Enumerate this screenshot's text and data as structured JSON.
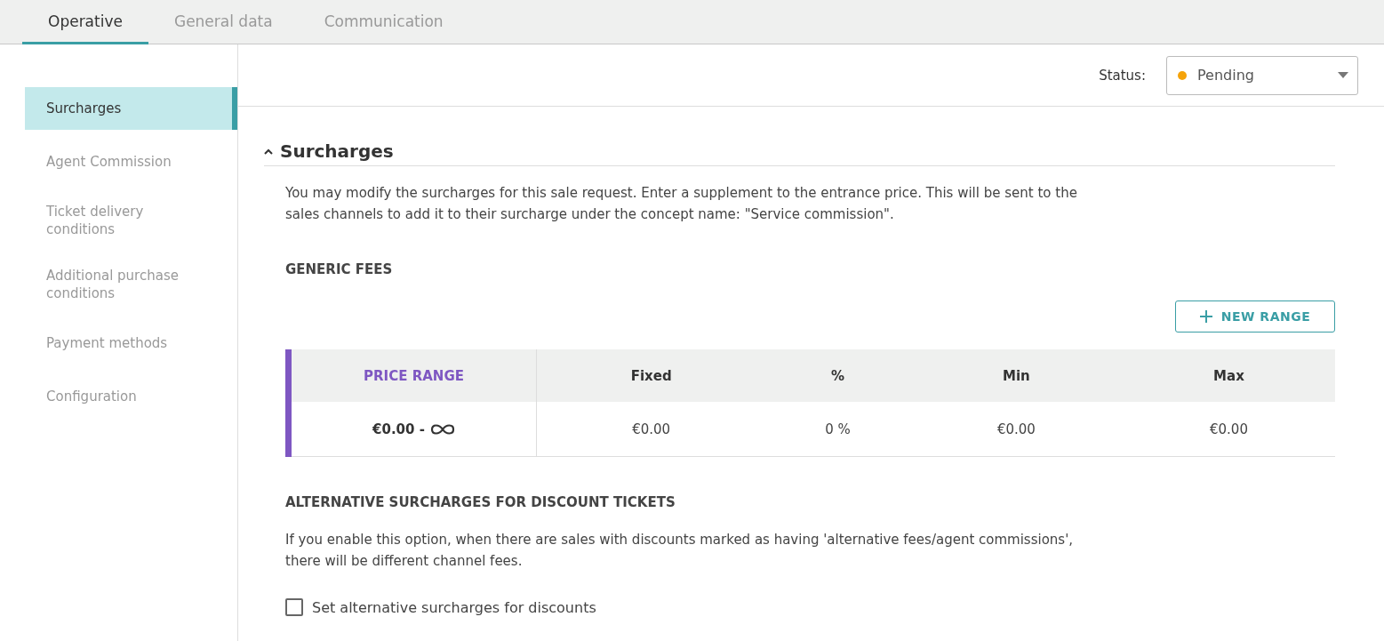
{
  "tabs": [
    {
      "label": "Operative",
      "selected": true
    },
    {
      "label": "General data",
      "selected": false
    },
    {
      "label": "Communication",
      "selected": false
    }
  ],
  "sidebar": {
    "items": [
      {
        "label": "Surcharges",
        "selected": true
      },
      {
        "label": "Agent Commission",
        "selected": false
      },
      {
        "label": "Ticket delivery conditions",
        "selected": false
      },
      {
        "label": "Additional purchase conditions",
        "selected": false
      },
      {
        "label": "Payment methods",
        "selected": false
      },
      {
        "label": "Configuration",
        "selected": false
      }
    ]
  },
  "status": {
    "label": "Status:",
    "value": "Pending",
    "color": "#f5a30a"
  },
  "section": {
    "title": "Surcharges",
    "expanded": true,
    "description": "You may modify the surcharges for this sale request. Enter a supplement to the entrance price. This will be sent to the sales channels to add it to their surcharge under the concept name: \"Service commission\".",
    "generic_fees": {
      "title": "GENERIC FEES",
      "button": "NEW RANGE",
      "table": {
        "columns": [
          "PRICE RANGE",
          "Fixed",
          "%",
          "Min",
          "Max"
        ],
        "rows": [
          [
            "€0.00 -",
            "€0.00",
            "0 %",
            "€0.00",
            "€0.00"
          ]
        ]
      }
    },
    "alternative": {
      "title": "ALTERNATIVE SURCHARGES FOR DISCOUNT TICKETS",
      "description": "If you enable this option, when there are sales with discounts marked as having 'alternative fees/agent commissions', there will be different channel fees.",
      "checkbox": {
        "label": "Set alternative surcharges for discounts",
        "checked": false
      }
    }
  }
}
